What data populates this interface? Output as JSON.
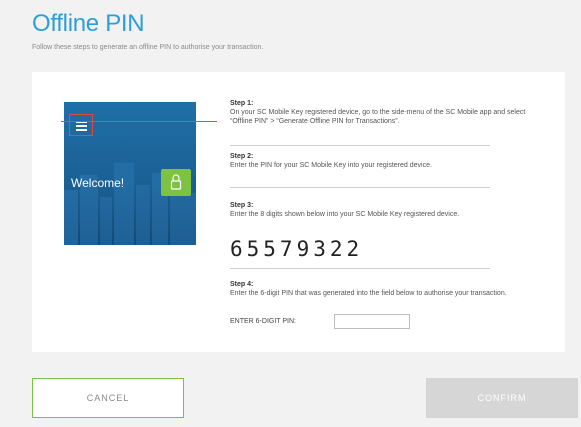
{
  "header": {
    "title": "Offline PIN",
    "subtitle": "Follow these steps to generate an offline PIN to authorise your transaction."
  },
  "illustration": {
    "welcome_text": "Welcome!",
    "icons": [
      "menu-icon",
      "lock-icon"
    ]
  },
  "steps": [
    {
      "label": "Step 1:",
      "desc": "On your SC Mobile Key registered device, go to the side-menu of the SC Mobile app and select “Offline PIN” > “Generate Offline PIN for Transactions”."
    },
    {
      "label": "Step 2:",
      "desc": "Enter the PIN for your SC Mobile Key into your registered device."
    },
    {
      "label": "Step 3:",
      "desc": "Enter the 8 digits shown below into your SC Mobile Key registered device."
    },
    {
      "label": "Step 4:",
      "desc": "Enter the 6-digit PIN that was generated into the field below to authorise your transaction."
    }
  ],
  "pin_digits": "65579322",
  "pin_input": {
    "label": "ENTER 6-DIGIT PIN:",
    "value": ""
  },
  "buttons": {
    "cancel": "CANCEL",
    "confirm": "CONFIRM"
  },
  "colors": {
    "title": "#2c9fd9",
    "accent_green": "#7dc242",
    "pointer_red": "#e04a3d",
    "confirm_disabled": "#d6d6d6"
  }
}
